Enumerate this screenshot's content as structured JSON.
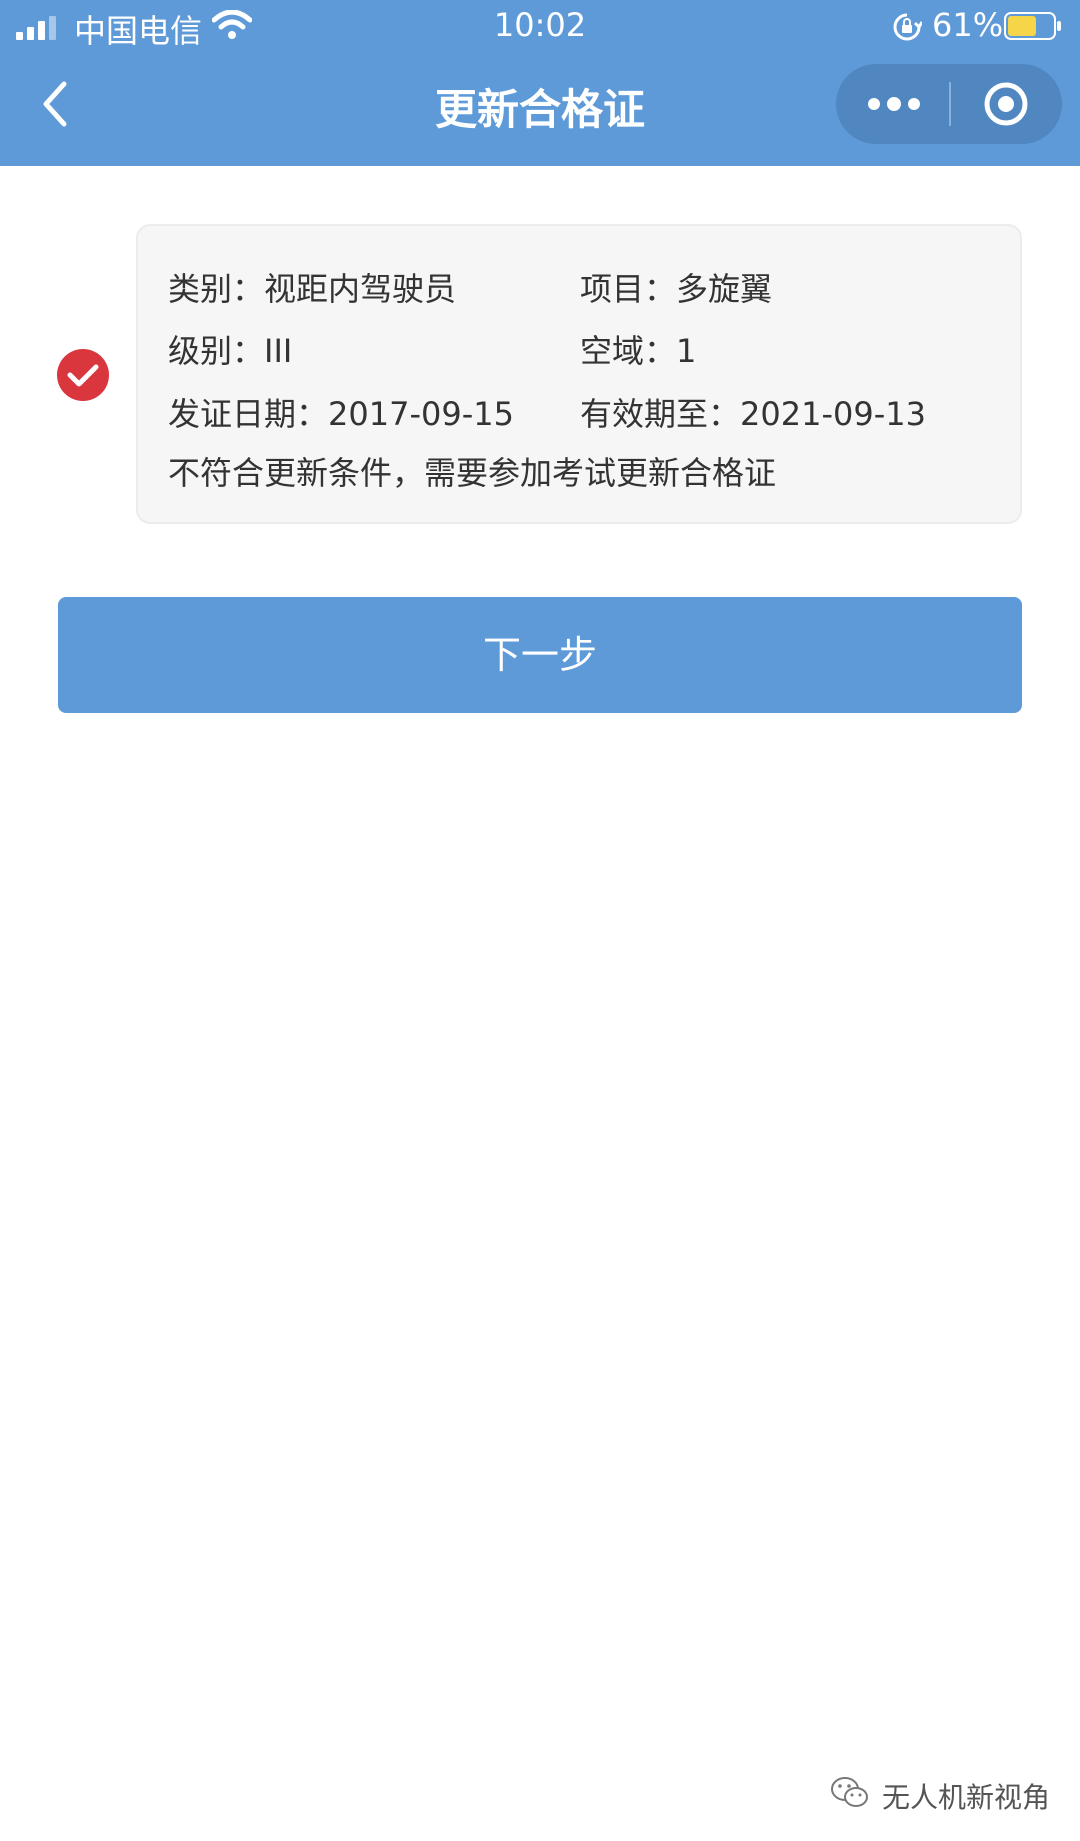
{
  "status_bar": {
    "carrier": "中国电信",
    "time": "10:02",
    "battery": "61%",
    "icons": [
      "signal-icon",
      "wifi-icon",
      "orientation-lock-icon",
      "battery-icon"
    ]
  },
  "nav": {
    "title": "更新合格证",
    "back_icon": "chevron-left-icon",
    "more_icon": "more-dots-icon",
    "close_icon": "target-circle-icon"
  },
  "certificate": {
    "selected": true,
    "category_label": "类别：",
    "category_value": "视距内驾驶员",
    "project_label": "项目：",
    "project_value": "多旋翼",
    "level_label": "级别：",
    "level_value": "III",
    "airspace_label": "空域：",
    "airspace_value": "1",
    "issue_date_label": "发证日期：",
    "issue_date_value": "2017-09-15",
    "valid_until_label": "有效期至：",
    "valid_until_value": "2021-09-13",
    "note": "不符合更新条件，需要参加考试更新合格证"
  },
  "next_button": {
    "label": "下一步"
  },
  "watermark": {
    "text": "无人机新视角",
    "icon": "wechat-icon"
  },
  "colors": {
    "primary": "#5e9ad8",
    "check": "#d9363e",
    "card_bg": "#f6f6f6",
    "text": "#333333"
  }
}
